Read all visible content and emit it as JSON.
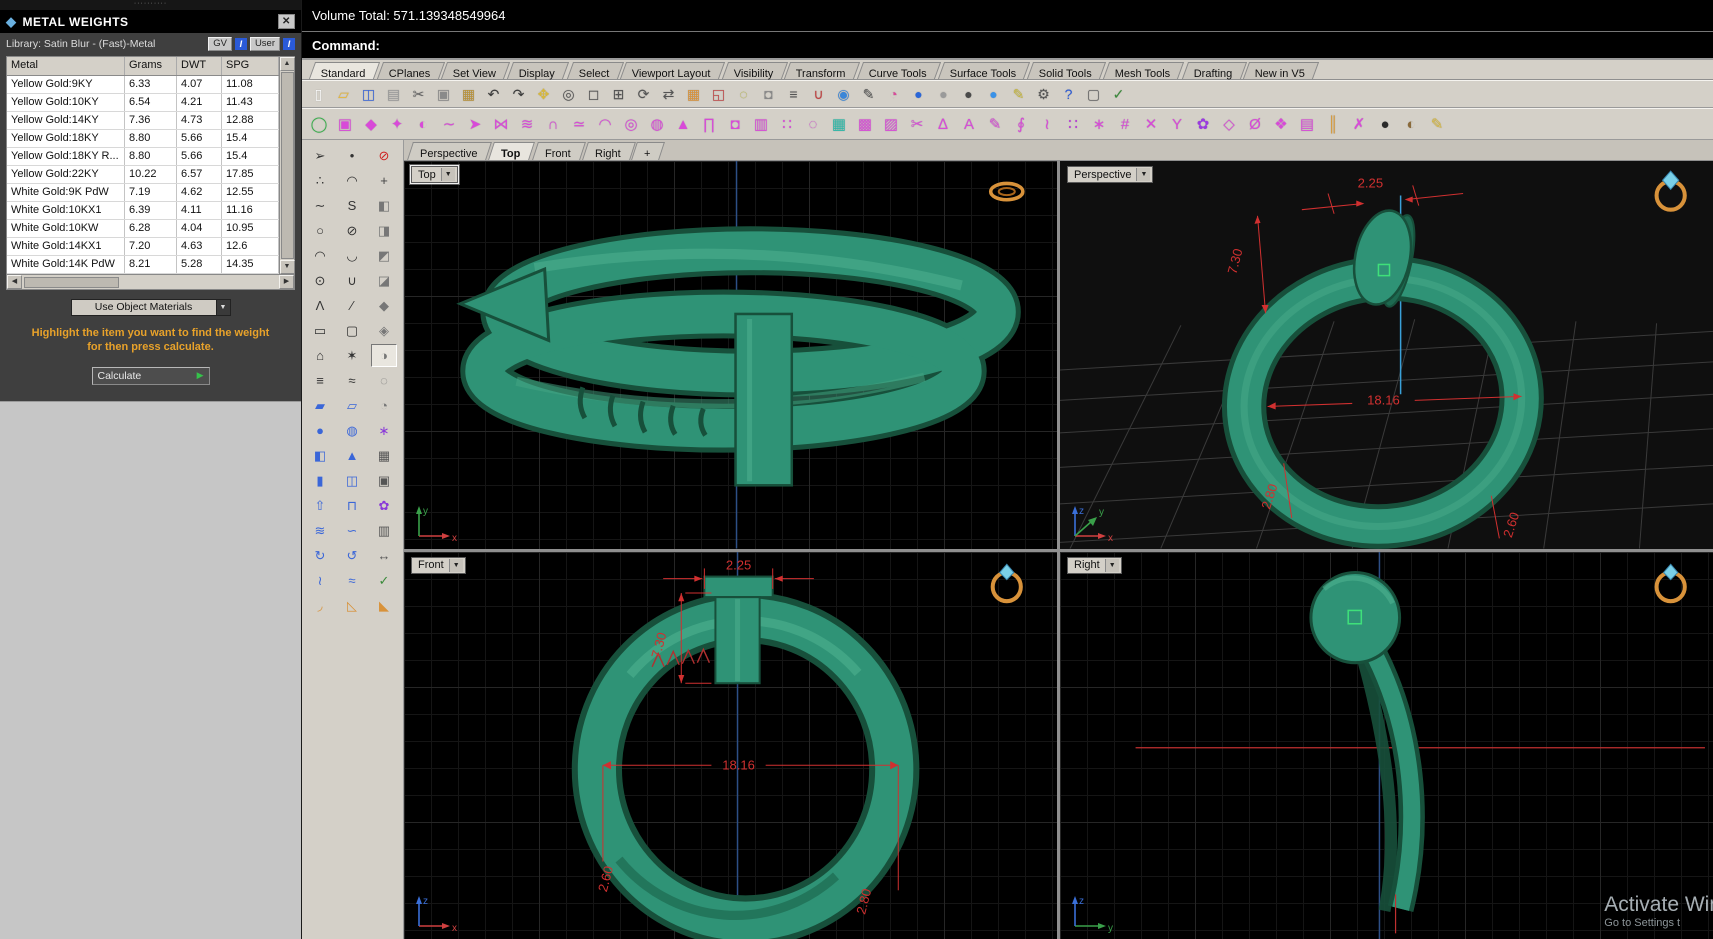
{
  "icons": {
    "dropdown_arrow": "▼",
    "close": "✕",
    "play_arrow": "▶",
    "scroll_up": "▲",
    "scroll_down": "▼",
    "scroll_left": "◀",
    "scroll_right": "▶",
    "gem": "◆",
    "drag_dots": "··········"
  },
  "metal_weights": {
    "title": "METAL WEIGHTS",
    "library_label": "Library: Satin Blur - (Fast)-Metal",
    "gv_button": "GV",
    "user_button": "User",
    "info_badge": "I",
    "columns": [
      "Metal",
      "Grams",
      "DWT",
      "SPG"
    ],
    "rows": [
      {
        "metal": "Yellow Gold:9KY",
        "grams": "6.33",
        "dwt": "4.07",
        "spg": "11.08"
      },
      {
        "metal": "Yellow Gold:10KY",
        "grams": "6.54",
        "dwt": "4.21",
        "spg": "11.43"
      },
      {
        "metal": "Yellow Gold:14KY",
        "grams": "7.36",
        "dwt": "4.73",
        "spg": "12.88"
      },
      {
        "metal": "Yellow Gold:18KY",
        "grams": "8.80",
        "dwt": "5.66",
        "spg": "15.4"
      },
      {
        "metal": "Yellow Gold:18KY R...",
        "grams": "8.80",
        "dwt": "5.66",
        "spg": "15.4"
      },
      {
        "metal": "Yellow Gold:22KY",
        "grams": "10.22",
        "dwt": "6.57",
        "spg": "17.85"
      },
      {
        "metal": "White Gold:9K PdW",
        "grams": "7.19",
        "dwt": "4.62",
        "spg": "12.55"
      },
      {
        "metal": "White Gold:10KX1",
        "grams": "6.39",
        "dwt": "4.11",
        "spg": "11.16"
      },
      {
        "metal": "White Gold:10KW",
        "grams": "6.28",
        "dwt": "4.04",
        "spg": "10.95"
      },
      {
        "metal": "White Gold:14KX1",
        "grams": "7.20",
        "dwt": "4.63",
        "spg": "12.6"
      },
      {
        "metal": "White Gold:14K PdW",
        "grams": "8.21",
        "dwt": "5.28",
        "spg": "14.35"
      }
    ],
    "materials_dropdown_value": "Use Object Materials",
    "instruction_line1": "Highlight the item you want to find the weight",
    "instruction_line2": "for then press calculate.",
    "calculate_button": "Calculate"
  },
  "status_bar": {
    "volume_total": "Volume Total: 571.139348549964",
    "command_prompt": "Command:"
  },
  "menu_tabs": [
    {
      "name": "tab-standard",
      "label": "Standard",
      "active": true
    },
    {
      "name": "tab-cplanes",
      "label": "CPlanes"
    },
    {
      "name": "tab-set-view",
      "label": "Set View"
    },
    {
      "name": "tab-display",
      "label": "Display"
    },
    {
      "name": "tab-select",
      "label": "Select"
    },
    {
      "name": "tab-viewport-layout",
      "label": "Viewport Layout"
    },
    {
      "name": "tab-visibility",
      "label": "Visibility"
    },
    {
      "name": "tab-transform",
      "label": "Transform"
    },
    {
      "name": "tab-curve-tools",
      "label": "Curve Tools"
    },
    {
      "name": "tab-surface-tools",
      "label": "Surface Tools"
    },
    {
      "name": "tab-solid-tools",
      "label": "Solid Tools"
    },
    {
      "name": "tab-mesh-tools",
      "label": "Mesh Tools"
    },
    {
      "name": "tab-drafting",
      "label": "Drafting"
    },
    {
      "name": "tab-new-in-v5",
      "label": "New in V5"
    }
  ],
  "toolbar_main": [
    {
      "name": "new-file-icon",
      "glyph": "▯",
      "color": "#fdfdfd"
    },
    {
      "name": "open-file-icon",
      "glyph": "▱",
      "color": "#e8b83a"
    },
    {
      "name": "save-icon",
      "glyph": "◫",
      "color": "#3a66d8"
    },
    {
      "name": "print-icon",
      "glyph": "▤",
      "color": "#9a9a9a"
    },
    {
      "name": "cut-icon",
      "glyph": "✂",
      "color": "#666666"
    },
    {
      "name": "copy-icon",
      "glyph": "▣",
      "color": "#8a8a8a"
    },
    {
      "name": "paste-icon",
      "glyph": "▦",
      "color": "#b8923a"
    },
    {
      "name": "undo-icon",
      "glyph": "↶",
      "color": "#3a3a3a"
    },
    {
      "name": "redo-icon",
      "glyph": "↷",
      "color": "#3a3a3a"
    },
    {
      "name": "pan-icon",
      "glyph": "✥",
      "color": "#d8b83a"
    },
    {
      "name": "zoom-icon",
      "glyph": "◎",
      "color": "#555555"
    },
    {
      "name": "zoom-window-icon",
      "glyph": "◻",
      "color": "#555555"
    },
    {
      "name": "zoom-extents-icon",
      "glyph": "⊞",
      "color": "#555555"
    },
    {
      "name": "rotate-view-icon",
      "glyph": "⟳",
      "color": "#555555"
    },
    {
      "name": "pan-view-icon",
      "glyph": "⇄",
      "color": "#555555"
    },
    {
      "name": "grid-snap-icon",
      "glyph": "▦",
      "color": "#d8923a"
    },
    {
      "name": "named-views-icon",
      "glyph": "◱",
      "color": "#c04a4a"
    },
    {
      "name": "hide-objects-icon",
      "glyph": "◌",
      "color": "#b8b83a"
    },
    {
      "name": "lock-objects-icon",
      "glyph": "◘",
      "color": "#888888"
    },
    {
      "name": "layers-icon",
      "glyph": "≡",
      "color": "#555555"
    },
    {
      "name": "object-snap-icon",
      "glyph": "∪",
      "color": "#c04040"
    },
    {
      "name": "gumball-icon",
      "glyph": "◉",
      "color": "#3a86d8"
    },
    {
      "name": "record-history-icon",
      "glyph": "✎",
      "color": "#555555"
    },
    {
      "name": "color-wheel-icon",
      "glyph": "◔",
      "color": "#d84a9a"
    },
    {
      "name": "render-icon",
      "glyph": "●",
      "color": "#2a66d8"
    },
    {
      "name": "shaded-view-icon",
      "glyph": "●",
      "color": "#9a9a9a"
    },
    {
      "name": "ghosted-view-icon",
      "glyph": "●",
      "color": "#4a4a4a"
    },
    {
      "name": "raytrace-view-icon",
      "glyph": "●",
      "color": "#3a92e8"
    },
    {
      "name": "notes-icon",
      "glyph": "✎",
      "color": "#c8b83a"
    },
    {
      "name": "options-icon",
      "glyph": "⚙",
      "color": "#555555"
    },
    {
      "name": "help-icon",
      "glyph": "?",
      "color": "#2a5ad8"
    },
    {
      "name": "selection-box-icon",
      "glyph": "▢",
      "color": "#666666"
    },
    {
      "name": "check-edit-icon",
      "glyph": "✓",
      "color": "#3a8a3a"
    }
  ],
  "toolbar_jewelry": [
    {
      "name": "history-toggle-icon",
      "glyph": "◯",
      "color": "#35b24a"
    },
    {
      "name": "matrix-cube-icon",
      "glyph": "▣",
      "color": "#d84ad8"
    },
    {
      "name": "gem-studio-icon",
      "glyph": "◆",
      "color": "#d84ad8"
    },
    {
      "name": "gem-loader-icon",
      "glyph": "✦",
      "color": "#d84ad8"
    },
    {
      "name": "profile-placer-icon",
      "glyph": "◐",
      "color": "#d84ad8"
    },
    {
      "name": "curve-studio-icon",
      "glyph": "∼",
      "color": "#d84ad8"
    },
    {
      "name": "arrow-builder-icon",
      "glyph": "➤",
      "color": "#d84ad8"
    },
    {
      "name": "mirror-builder-icon",
      "glyph": "⋈",
      "color": "#d84ad8"
    },
    {
      "name": "rail-sweep-icon",
      "glyph": "≋",
      "color": "#d84ad8"
    },
    {
      "name": "magnet-snap-icon",
      "glyph": "∩",
      "color": "#d84ad8"
    },
    {
      "name": "loft-builder-icon",
      "glyph": "≃",
      "color": "#d84ad8"
    },
    {
      "name": "arc-bend-icon",
      "glyph": "◠",
      "color": "#d84ad8"
    },
    {
      "name": "pipe-builder-icon",
      "glyph": "◎",
      "color": "#d84ad8"
    },
    {
      "name": "ring-rail-icon",
      "glyph": "◍",
      "color": "#d84ad8"
    },
    {
      "name": "head-builder-icon",
      "glyph": "▲",
      "color": "#d84ad8"
    },
    {
      "name": "prong-builder-icon",
      "glyph": "∏",
      "color": "#d84ad8"
    },
    {
      "name": "bezel-builder-icon",
      "glyph": "◘",
      "color": "#d84ad8"
    },
    {
      "name": "channel-cutter-icon",
      "glyph": "▥",
      "color": "#d84ad8"
    },
    {
      "name": "pave-tool-icon",
      "glyph": "∷",
      "color": "#d84ad8"
    },
    {
      "name": "halo-builder-icon",
      "glyph": "◌",
      "color": "#d84ad8"
    },
    {
      "name": "surface-grid-icon",
      "glyph": "▦",
      "color": "#2ab8a8"
    },
    {
      "name": "mesh-grid-icon",
      "glyph": "▩",
      "color": "#d84ad8"
    },
    {
      "name": "gem-map-icon",
      "glyph": "▨",
      "color": "#d84ad8"
    },
    {
      "name": "cutter-tool-icon",
      "glyph": "✂",
      "color": "#d84ad8"
    },
    {
      "name": "weight-calc-icon",
      "glyph": "∆",
      "color": "#d84ad8"
    },
    {
      "name": "text-builder-icon",
      "glyph": "A",
      "color": "#d84ad8"
    },
    {
      "name": "engraver-icon",
      "glyph": "✎",
      "color": "#d84ad8"
    },
    {
      "name": "twist-tool-icon",
      "glyph": "∮",
      "color": "#d84ad8"
    },
    {
      "name": "flow-tool-icon",
      "glyph": "≀",
      "color": "#d84ad8"
    },
    {
      "name": "array-tool-icon",
      "glyph": "∷",
      "color": "#b83ad8"
    },
    {
      "name": "gem-scatter-icon",
      "glyph": "∗",
      "color": "#d84ad8"
    },
    {
      "name": "measure-tool-icon",
      "glyph": "#",
      "color": "#d84ad8"
    },
    {
      "name": "stitcher-icon",
      "glyph": "✕",
      "color": "#d84ad8"
    },
    {
      "name": "branch-builder-icon",
      "glyph": "Y",
      "color": "#d84ad8"
    },
    {
      "name": "flower-builder-icon",
      "glyph": "✿",
      "color": "#9a3ae0"
    },
    {
      "name": "diamond-outline-icon",
      "glyph": "◇",
      "color": "#d84ad8"
    },
    {
      "name": "ring-sizer-icon",
      "glyph": "Ø",
      "color": "#d84ad8"
    },
    {
      "name": "hex-gem-icon",
      "glyph": "❖",
      "color": "#d84ad8"
    },
    {
      "name": "mesh-repair-icon",
      "glyph": "▤",
      "color": "#d84ad8"
    },
    {
      "name": "column-chart-icon",
      "glyph": "║",
      "color": "#d89a3a"
    },
    {
      "name": "delete-tool-icon",
      "glyph": "✗",
      "color": "#d84ad8"
    },
    {
      "name": "dark-sphere-icon",
      "glyph": "●",
      "color": "#2a2a2a"
    },
    {
      "name": "earth-icon",
      "glyph": "◐",
      "color": "#8a6a3a"
    },
    {
      "name": "pencil-tilt-icon",
      "glyph": "✎",
      "color": "#d8b83a"
    }
  ],
  "side_toolbar": [
    {
      "name": "pointer-icon",
      "glyph": "➢",
      "color": "#333333"
    },
    {
      "name": "control-points-icon",
      "glyph": "∴",
      "color": "#333333"
    },
    {
      "name": "curve-icon",
      "glyph": "∼",
      "color": "#333333"
    },
    {
      "name": "circle-icon",
      "glyph": "○",
      "color": "#333333"
    },
    {
      "name": "arc-icon",
      "glyph": "◠",
      "color": "#333333"
    },
    {
      "name": "ellipse-icon",
      "glyph": "⊙",
      "color": "#333333"
    },
    {
      "name": "polyline-icon",
      "glyph": "Λ",
      "color": "#333333"
    },
    {
      "name": "rectangle-icon",
      "glyph": "▭",
      "color": "#333333"
    },
    {
      "name": "polygon-icon",
      "glyph": "⌂",
      "color": "#333333"
    },
    {
      "name": "offset-curve-icon",
      "glyph": "≡",
      "color": "#333333"
    },
    {
      "name": "surface-plane-icon",
      "glyph": "▰",
      "color": "#3a66d8"
    },
    {
      "name": "sphere-icon",
      "glyph": "●",
      "color": "#3a66d8"
    },
    {
      "name": "box-icon",
      "glyph": "◧",
      "color": "#3a66d8"
    },
    {
      "name": "cylinder-icon",
      "glyph": "▮",
      "color": "#3a66d8"
    },
    {
      "name": "extrude-icon",
      "glyph": "⇧",
      "color": "#3a66d8"
    },
    {
      "name": "loft-icon",
      "glyph": "≋",
      "color": "#3a66d8"
    },
    {
      "name": "revolve-icon",
      "glyph": "↻",
      "color": "#3a66d8"
    },
    {
      "name": "sweep-icon",
      "glyph": "≀",
      "color": "#3a66d8"
    },
    {
      "name": "fillet-icon",
      "glyph": "◞",
      "color": "#d8923a"
    },
    {
      "name": "point-icon",
      "glyph": "•",
      "color": "#333333"
    },
    {
      "name": "curve-through-points-icon",
      "glyph": "◠",
      "color": "#333333"
    },
    {
      "name": "interpolate-curve-icon",
      "glyph": "S",
      "color": "#333333"
    },
    {
      "name": "circle-diameter-icon",
      "glyph": "⊘",
      "color": "#333333"
    },
    {
      "name": "arc-3pt-icon",
      "glyph": "◡",
      "color": "#333333"
    },
    {
      "name": "conic-icon",
      "glyph": "∪",
      "color": "#333333"
    },
    {
      "name": "line-icon",
      "glyph": "∕",
      "color": "#333333"
    },
    {
      "name": "rounded-rect-icon",
      "glyph": "▢",
      "color": "#333333"
    },
    {
      "name": "star-icon",
      "glyph": "✶",
      "color": "#333333"
    },
    {
      "name": "offset-surface-icon",
      "glyph": "≈",
      "color": "#333333"
    },
    {
      "name": "patch-surface-icon",
      "glyph": "▱",
      "color": "#3a66d8"
    },
    {
      "name": "torus-icon",
      "glyph": "◍",
      "color": "#3a66d8"
    },
    {
      "name": "cone-icon",
      "glyph": "▲",
      "color": "#3a66d8"
    },
    {
      "name": "tube-icon",
      "glyph": "◫",
      "color": "#3a66d8"
    },
    {
      "name": "cap-holes-icon",
      "glyph": "⊓",
      "color": "#3a66d8"
    },
    {
      "name": "blend-surface-icon",
      "glyph": "∽",
      "color": "#3a66d8"
    },
    {
      "name": "rail-revolve-icon",
      "glyph": "↺",
      "color": "#3a66d8"
    },
    {
      "name": "sweep2-icon",
      "glyph": "≈",
      "color": "#3a66d8"
    },
    {
      "name": "chamfer-icon",
      "glyph": "◺",
      "color": "#d8923a"
    },
    {
      "name": "cancel-icon",
      "glyph": "⊘",
      "color": "#d02020"
    },
    {
      "name": "cplane-icon",
      "glyph": "+",
      "color": "#444444"
    },
    {
      "name": "view-top-icon",
      "glyph": "◧",
      "color": "#777777"
    },
    {
      "name": "view-front-icon",
      "glyph": "◨",
      "color": "#777777"
    },
    {
      "name": "view-right-icon",
      "glyph": "◩",
      "color": "#777777"
    },
    {
      "name": "view-back-icon",
      "glyph": "◪",
      "color": "#777777"
    },
    {
      "name": "view-iso-icon",
      "glyph": "◆",
      "color": "#777777"
    },
    {
      "name": "view-bottom-icon",
      "glyph": "◈",
      "color": "#777777"
    },
    {
      "name": "shade-toggle-icon",
      "glyph": "◑",
      "color": "#777777",
      "pressed": true
    },
    {
      "name": "wireframe-toggle-icon",
      "glyph": "◌",
      "color": "#777777"
    },
    {
      "name": "xray-toggle-icon",
      "glyph": "◔",
      "color": "#777777"
    },
    {
      "name": "pattern-tool-icon",
      "glyph": "∗",
      "color": "#8a3ad8"
    },
    {
      "name": "grid-block-icon",
      "glyph": "▦",
      "color": "#555555"
    },
    {
      "name": "snapshot-icon",
      "glyph": "▣",
      "color": "#555555"
    },
    {
      "name": "flower-tool-icon",
      "glyph": "✿",
      "color": "#8a3ad8"
    },
    {
      "name": "layout-grid-icon",
      "glyph": "▥",
      "color": "#555555"
    },
    {
      "name": "dim-tool-icon",
      "glyph": "↔",
      "color": "#555555"
    },
    {
      "name": "check-tool-icon",
      "glyph": "✓",
      "color": "#3a8a3a"
    },
    {
      "name": "wedge-tool-icon",
      "glyph": "◣",
      "color": "#d8923a"
    }
  ],
  "viewport_tabs": [
    {
      "name": "vp-tab-perspective",
      "label": "Perspective"
    },
    {
      "name": "vp-tab-top",
      "label": "Top",
      "active": true
    },
    {
      "name": "vp-tab-front",
      "label": "Front"
    },
    {
      "name": "vp-tab-right",
      "label": "Right"
    },
    {
      "name": "vp-tab-new",
      "label": "+"
    }
  ],
  "viewports": {
    "top": {
      "label": "Top",
      "axis_h": "x",
      "axis_v": "y"
    },
    "perspective": {
      "label": "Perspective",
      "axis_h": "x",
      "axis_v": "z",
      "axis_d": "y",
      "dims": {
        "head_width": "2.25",
        "head_height": "7.30",
        "diameter": "18.16",
        "wire_left": "2.80",
        "wire_right": "2.60"
      }
    },
    "front": {
      "label": "Front",
      "axis_h": "x",
      "axis_v": "z",
      "dims": {
        "head_width": "2.25",
        "head_height": "7.30",
        "diameter": "18.16",
        "wire_left": "2.60",
        "wire_right": "2.80"
      }
    },
    "right": {
      "label": "Right",
      "axis_h": "y",
      "axis_v": "z"
    }
  },
  "watermark": {
    "line1": "Activate Win",
    "line2": "Go to Settings t"
  }
}
